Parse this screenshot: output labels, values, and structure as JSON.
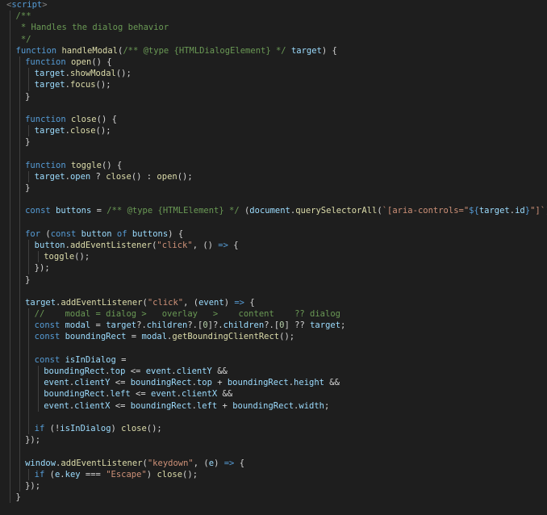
{
  "editor": {
    "lines": [
      {
        "indent": 0,
        "guides": 0,
        "tokens": [
          {
            "t": "<",
            "c": "punct"
          },
          {
            "t": "script",
            "c": "tag"
          },
          {
            "t": ">",
            "c": "punct"
          }
        ]
      },
      {
        "indent": 2,
        "guides": 1,
        "tokens": [
          {
            "t": "/**",
            "c": "comment"
          }
        ]
      },
      {
        "indent": 2,
        "guides": 1,
        "tokens": [
          {
            "t": " * Handles the dialog behavior",
            "c": "comment"
          }
        ]
      },
      {
        "indent": 2,
        "guides": 1,
        "tokens": [
          {
            "t": " */",
            "c": "comment"
          }
        ]
      },
      {
        "indent": 2,
        "guides": 1,
        "tokens": [
          {
            "t": "function ",
            "c": "keyword"
          },
          {
            "t": "handleModal",
            "c": "fn"
          },
          {
            "t": "(",
            "c": "plain"
          },
          {
            "t": "/** @type {HTMLDialogElement} */ ",
            "c": "comment"
          },
          {
            "t": "target",
            "c": "var"
          },
          {
            "t": ") {",
            "c": "plain"
          }
        ]
      },
      {
        "indent": 4,
        "guides": 2,
        "tokens": [
          {
            "t": "function ",
            "c": "keyword"
          },
          {
            "t": "open",
            "c": "fn"
          },
          {
            "t": "() {",
            "c": "plain"
          }
        ]
      },
      {
        "indent": 6,
        "guides": 3,
        "tokens": [
          {
            "t": "target",
            "c": "var"
          },
          {
            "t": ".",
            "c": "plain"
          },
          {
            "t": "showModal",
            "c": "fn"
          },
          {
            "t": "();",
            "c": "plain"
          }
        ]
      },
      {
        "indent": 6,
        "guides": 3,
        "tokens": [
          {
            "t": "target",
            "c": "var"
          },
          {
            "t": ".",
            "c": "plain"
          },
          {
            "t": "focus",
            "c": "fn"
          },
          {
            "t": "();",
            "c": "plain"
          }
        ]
      },
      {
        "indent": 4,
        "guides": 2,
        "tokens": [
          {
            "t": "}",
            "c": "plain"
          }
        ]
      },
      {
        "indent": 0,
        "guides": 2,
        "tokens": []
      },
      {
        "indent": 4,
        "guides": 2,
        "tokens": [
          {
            "t": "function ",
            "c": "keyword"
          },
          {
            "t": "close",
            "c": "fn"
          },
          {
            "t": "() {",
            "c": "plain"
          }
        ]
      },
      {
        "indent": 6,
        "guides": 3,
        "tokens": [
          {
            "t": "target",
            "c": "var"
          },
          {
            "t": ".",
            "c": "plain"
          },
          {
            "t": "close",
            "c": "fn"
          },
          {
            "t": "();",
            "c": "plain"
          }
        ]
      },
      {
        "indent": 4,
        "guides": 2,
        "tokens": [
          {
            "t": "}",
            "c": "plain"
          }
        ]
      },
      {
        "indent": 0,
        "guides": 2,
        "tokens": []
      },
      {
        "indent": 4,
        "guides": 2,
        "tokens": [
          {
            "t": "function ",
            "c": "keyword"
          },
          {
            "t": "toggle",
            "c": "fn"
          },
          {
            "t": "() {",
            "c": "plain"
          }
        ]
      },
      {
        "indent": 6,
        "guides": 3,
        "tokens": [
          {
            "t": "target",
            "c": "var"
          },
          {
            "t": ".",
            "c": "plain"
          },
          {
            "t": "open",
            "c": "var"
          },
          {
            "t": " ? ",
            "c": "plain"
          },
          {
            "t": "close",
            "c": "fn"
          },
          {
            "t": "() : ",
            "c": "plain"
          },
          {
            "t": "open",
            "c": "fn"
          },
          {
            "t": "();",
            "c": "plain"
          }
        ]
      },
      {
        "indent": 4,
        "guides": 2,
        "tokens": [
          {
            "t": "}",
            "c": "plain"
          }
        ]
      },
      {
        "indent": 0,
        "guides": 2,
        "tokens": []
      },
      {
        "indent": 4,
        "guides": 2,
        "tokens": [
          {
            "t": "const ",
            "c": "keyword"
          },
          {
            "t": "buttons",
            "c": "var"
          },
          {
            "t": " = ",
            "c": "plain"
          },
          {
            "t": "/** @type {HTMLElement} */ ",
            "c": "comment"
          },
          {
            "t": "(",
            "c": "plain"
          },
          {
            "t": "document",
            "c": "var"
          },
          {
            "t": ".",
            "c": "plain"
          },
          {
            "t": "querySelectorAll",
            "c": "fn"
          },
          {
            "t": "(",
            "c": "plain"
          },
          {
            "t": "`[aria-controls=\"",
            "c": "string"
          },
          {
            "t": "${",
            "c": "tpl"
          },
          {
            "t": "target",
            "c": "var"
          },
          {
            "t": ".",
            "c": "plain"
          },
          {
            "t": "id",
            "c": "var"
          },
          {
            "t": "}",
            "c": "tpl"
          },
          {
            "t": "\"]`",
            "c": "string"
          },
          {
            "t": "));",
            "c": "plain"
          }
        ]
      },
      {
        "indent": 0,
        "guides": 2,
        "tokens": []
      },
      {
        "indent": 4,
        "guides": 2,
        "tokens": [
          {
            "t": "for ",
            "c": "keyword"
          },
          {
            "t": "(",
            "c": "plain"
          },
          {
            "t": "const ",
            "c": "keyword"
          },
          {
            "t": "button",
            "c": "var"
          },
          {
            "t": " of ",
            "c": "keyword"
          },
          {
            "t": "buttons",
            "c": "var"
          },
          {
            "t": ") {",
            "c": "plain"
          }
        ]
      },
      {
        "indent": 6,
        "guides": 3,
        "tokens": [
          {
            "t": "button",
            "c": "var"
          },
          {
            "t": ".",
            "c": "plain"
          },
          {
            "t": "addEventListener",
            "c": "fn"
          },
          {
            "t": "(",
            "c": "plain"
          },
          {
            "t": "\"click\"",
            "c": "string"
          },
          {
            "t": ", () ",
            "c": "plain"
          },
          {
            "t": "=>",
            "c": "keyword"
          },
          {
            "t": " {",
            "c": "plain"
          }
        ]
      },
      {
        "indent": 8,
        "guides": 4,
        "tokens": [
          {
            "t": "toggle",
            "c": "fn"
          },
          {
            "t": "();",
            "c": "plain"
          }
        ]
      },
      {
        "indent": 6,
        "guides": 3,
        "tokens": [
          {
            "t": "});",
            "c": "plain"
          }
        ]
      },
      {
        "indent": 4,
        "guides": 2,
        "tokens": [
          {
            "t": "}",
            "c": "plain"
          }
        ]
      },
      {
        "indent": 0,
        "guides": 2,
        "tokens": []
      },
      {
        "indent": 4,
        "guides": 2,
        "tokens": [
          {
            "t": "target",
            "c": "var"
          },
          {
            "t": ".",
            "c": "plain"
          },
          {
            "t": "addEventListener",
            "c": "fn"
          },
          {
            "t": "(",
            "c": "plain"
          },
          {
            "t": "\"click\"",
            "c": "string"
          },
          {
            "t": ", (",
            "c": "plain"
          },
          {
            "t": "event",
            "c": "var"
          },
          {
            "t": ") ",
            "c": "plain"
          },
          {
            "t": "=>",
            "c": "keyword"
          },
          {
            "t": " {",
            "c": "plain"
          }
        ]
      },
      {
        "indent": 6,
        "guides": 3,
        "tokens": [
          {
            "t": "//    modal = dialog >   overlay   >    content    ?? dialog",
            "c": "comment"
          }
        ]
      },
      {
        "indent": 6,
        "guides": 3,
        "tokens": [
          {
            "t": "const ",
            "c": "keyword"
          },
          {
            "t": "modal",
            "c": "var"
          },
          {
            "t": " = ",
            "c": "plain"
          },
          {
            "t": "target",
            "c": "var"
          },
          {
            "t": "?.",
            "c": "plain"
          },
          {
            "t": "children",
            "c": "var"
          },
          {
            "t": "?.[",
            "c": "plain"
          },
          {
            "t": "0",
            "c": "num"
          },
          {
            "t": "]?.",
            "c": "plain"
          },
          {
            "t": "children",
            "c": "var"
          },
          {
            "t": "?.[",
            "c": "plain"
          },
          {
            "t": "0",
            "c": "num"
          },
          {
            "t": "] ?? ",
            "c": "plain"
          },
          {
            "t": "target",
            "c": "var"
          },
          {
            "t": ";",
            "c": "plain"
          }
        ]
      },
      {
        "indent": 6,
        "guides": 3,
        "tokens": [
          {
            "t": "const ",
            "c": "keyword"
          },
          {
            "t": "boundingRect",
            "c": "var"
          },
          {
            "t": " = ",
            "c": "plain"
          },
          {
            "t": "modal",
            "c": "var"
          },
          {
            "t": ".",
            "c": "plain"
          },
          {
            "t": "getBoundingClientRect",
            "c": "fn"
          },
          {
            "t": "();",
            "c": "plain"
          }
        ]
      },
      {
        "indent": 0,
        "guides": 3,
        "tokens": []
      },
      {
        "indent": 6,
        "guides": 3,
        "tokens": [
          {
            "t": "const ",
            "c": "keyword"
          },
          {
            "t": "isInDialog",
            "c": "var"
          },
          {
            "t": " =",
            "c": "plain"
          }
        ]
      },
      {
        "indent": 8,
        "guides": 4,
        "tokens": [
          {
            "t": "boundingRect",
            "c": "var"
          },
          {
            "t": ".",
            "c": "plain"
          },
          {
            "t": "top",
            "c": "var"
          },
          {
            "t": " <= ",
            "c": "plain"
          },
          {
            "t": "event",
            "c": "var"
          },
          {
            "t": ".",
            "c": "plain"
          },
          {
            "t": "clientY",
            "c": "var"
          },
          {
            "t": " &&",
            "c": "plain"
          }
        ]
      },
      {
        "indent": 8,
        "guides": 4,
        "tokens": [
          {
            "t": "event",
            "c": "var"
          },
          {
            "t": ".",
            "c": "plain"
          },
          {
            "t": "clientY",
            "c": "var"
          },
          {
            "t": " <= ",
            "c": "plain"
          },
          {
            "t": "boundingRect",
            "c": "var"
          },
          {
            "t": ".",
            "c": "plain"
          },
          {
            "t": "top",
            "c": "var"
          },
          {
            "t": " + ",
            "c": "plain"
          },
          {
            "t": "boundingRect",
            "c": "var"
          },
          {
            "t": ".",
            "c": "plain"
          },
          {
            "t": "height",
            "c": "var"
          },
          {
            "t": " &&",
            "c": "plain"
          }
        ]
      },
      {
        "indent": 8,
        "guides": 4,
        "tokens": [
          {
            "t": "boundingRect",
            "c": "var"
          },
          {
            "t": ".",
            "c": "plain"
          },
          {
            "t": "left",
            "c": "var"
          },
          {
            "t": " <= ",
            "c": "plain"
          },
          {
            "t": "event",
            "c": "var"
          },
          {
            "t": ".",
            "c": "plain"
          },
          {
            "t": "clientX",
            "c": "var"
          },
          {
            "t": " &&",
            "c": "plain"
          }
        ]
      },
      {
        "indent": 8,
        "guides": 4,
        "tokens": [
          {
            "t": "event",
            "c": "var"
          },
          {
            "t": ".",
            "c": "plain"
          },
          {
            "t": "clientX",
            "c": "var"
          },
          {
            "t": " <= ",
            "c": "plain"
          },
          {
            "t": "boundingRect",
            "c": "var"
          },
          {
            "t": ".",
            "c": "plain"
          },
          {
            "t": "left",
            "c": "var"
          },
          {
            "t": " + ",
            "c": "plain"
          },
          {
            "t": "boundingRect",
            "c": "var"
          },
          {
            "t": ".",
            "c": "plain"
          },
          {
            "t": "width",
            "c": "var"
          },
          {
            "t": ";",
            "c": "plain"
          }
        ]
      },
      {
        "indent": 0,
        "guides": 3,
        "tokens": []
      },
      {
        "indent": 6,
        "guides": 3,
        "tokens": [
          {
            "t": "if ",
            "c": "keyword"
          },
          {
            "t": "(!",
            "c": "plain"
          },
          {
            "t": "isInDialog",
            "c": "var"
          },
          {
            "t": ") ",
            "c": "plain"
          },
          {
            "t": "close",
            "c": "fn"
          },
          {
            "t": "();",
            "c": "plain"
          }
        ]
      },
      {
        "indent": 4,
        "guides": 2,
        "tokens": [
          {
            "t": "});",
            "c": "plain"
          }
        ]
      },
      {
        "indent": 0,
        "guides": 2,
        "tokens": []
      },
      {
        "indent": 4,
        "guides": 2,
        "tokens": [
          {
            "t": "window",
            "c": "var"
          },
          {
            "t": ".",
            "c": "plain"
          },
          {
            "t": "addEventListener",
            "c": "fn"
          },
          {
            "t": "(",
            "c": "plain"
          },
          {
            "t": "\"keydown\"",
            "c": "string"
          },
          {
            "t": ", (",
            "c": "plain"
          },
          {
            "t": "e",
            "c": "var"
          },
          {
            "t": ") ",
            "c": "plain"
          },
          {
            "t": "=>",
            "c": "keyword"
          },
          {
            "t": " {",
            "c": "plain"
          }
        ]
      },
      {
        "indent": 6,
        "guides": 3,
        "tokens": [
          {
            "t": "if ",
            "c": "keyword"
          },
          {
            "t": "(",
            "c": "plain"
          },
          {
            "t": "e",
            "c": "var"
          },
          {
            "t": ".",
            "c": "plain"
          },
          {
            "t": "key",
            "c": "var"
          },
          {
            "t": " === ",
            "c": "plain"
          },
          {
            "t": "\"Escape\"",
            "c": "string"
          },
          {
            "t": ") ",
            "c": "plain"
          },
          {
            "t": "close",
            "c": "fn"
          },
          {
            "t": "();",
            "c": "plain"
          }
        ]
      },
      {
        "indent": 4,
        "guides": 2,
        "tokens": [
          {
            "t": "});",
            "c": "plain"
          }
        ]
      },
      {
        "indent": 2,
        "guides": 1,
        "tokens": [
          {
            "t": "}",
            "c": "plain"
          }
        ]
      }
    ]
  }
}
